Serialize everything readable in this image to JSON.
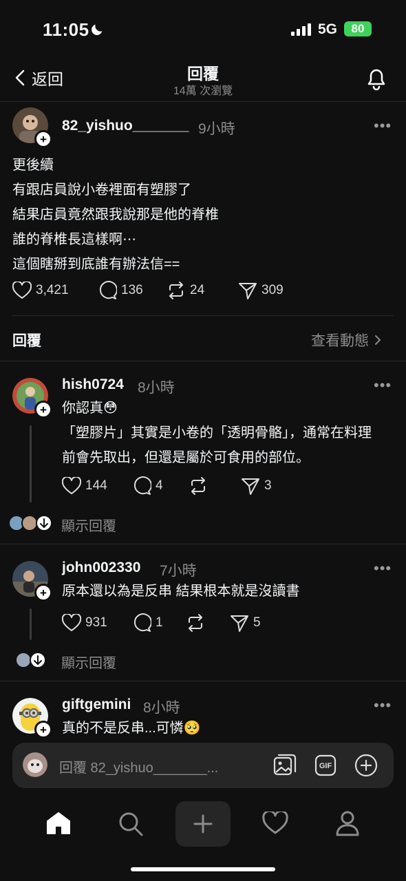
{
  "status": {
    "time": "11:05",
    "network": "5G",
    "battery": "80"
  },
  "header": {
    "back_label": "返回",
    "title": "回覆",
    "views": "14萬 次瀏覽"
  },
  "post": {
    "username": "82_yishuo_______",
    "time": "9小時",
    "lines": [
      "更後續",
      "有跟店員說小卷裡面有塑膠了",
      "結果店員竟然跟我說那是他的脊椎",
      "誰的脊椎長這樣啊⋯",
      "這個瞎掰到底誰有辦法信=="
    ],
    "likes": "3,421",
    "comments": "136",
    "reposts": "24",
    "shares": "309"
  },
  "replies_bar": {
    "label": "回覆",
    "activity": "查看動態"
  },
  "replies": [
    {
      "username": "hish0724",
      "time": "8小時",
      "lines": [
        "你認真😳",
        "「塑膠片」其實是小卷的「透明骨骼」，通常在料理",
        "前會先取出，但還是屬於可食用的部位。"
      ],
      "likes": "144",
      "comments": "4",
      "reposts": "",
      "shares": "3",
      "show_replies": "顯示回覆"
    },
    {
      "username": "john002330",
      "time": "7小時",
      "lines": [
        "原本還以為是反串 結果根本就是沒讀書"
      ],
      "likes": "931",
      "comments": "1",
      "reposts": "",
      "shares": "5",
      "show_replies": "顯示回覆"
    },
    {
      "username": "giftgemini",
      "time": "8小時",
      "lines": [
        "真的不是反串...可憐🥺"
      ]
    }
  ],
  "composer": {
    "placeholder": "回覆 82_yishuo_______..."
  },
  "tabs": [
    "home",
    "search",
    "create",
    "activity",
    "profile"
  ],
  "colors": {
    "background": "#101010",
    "battery": "#3fd25a",
    "secondary_text": "#8c8c8c"
  }
}
